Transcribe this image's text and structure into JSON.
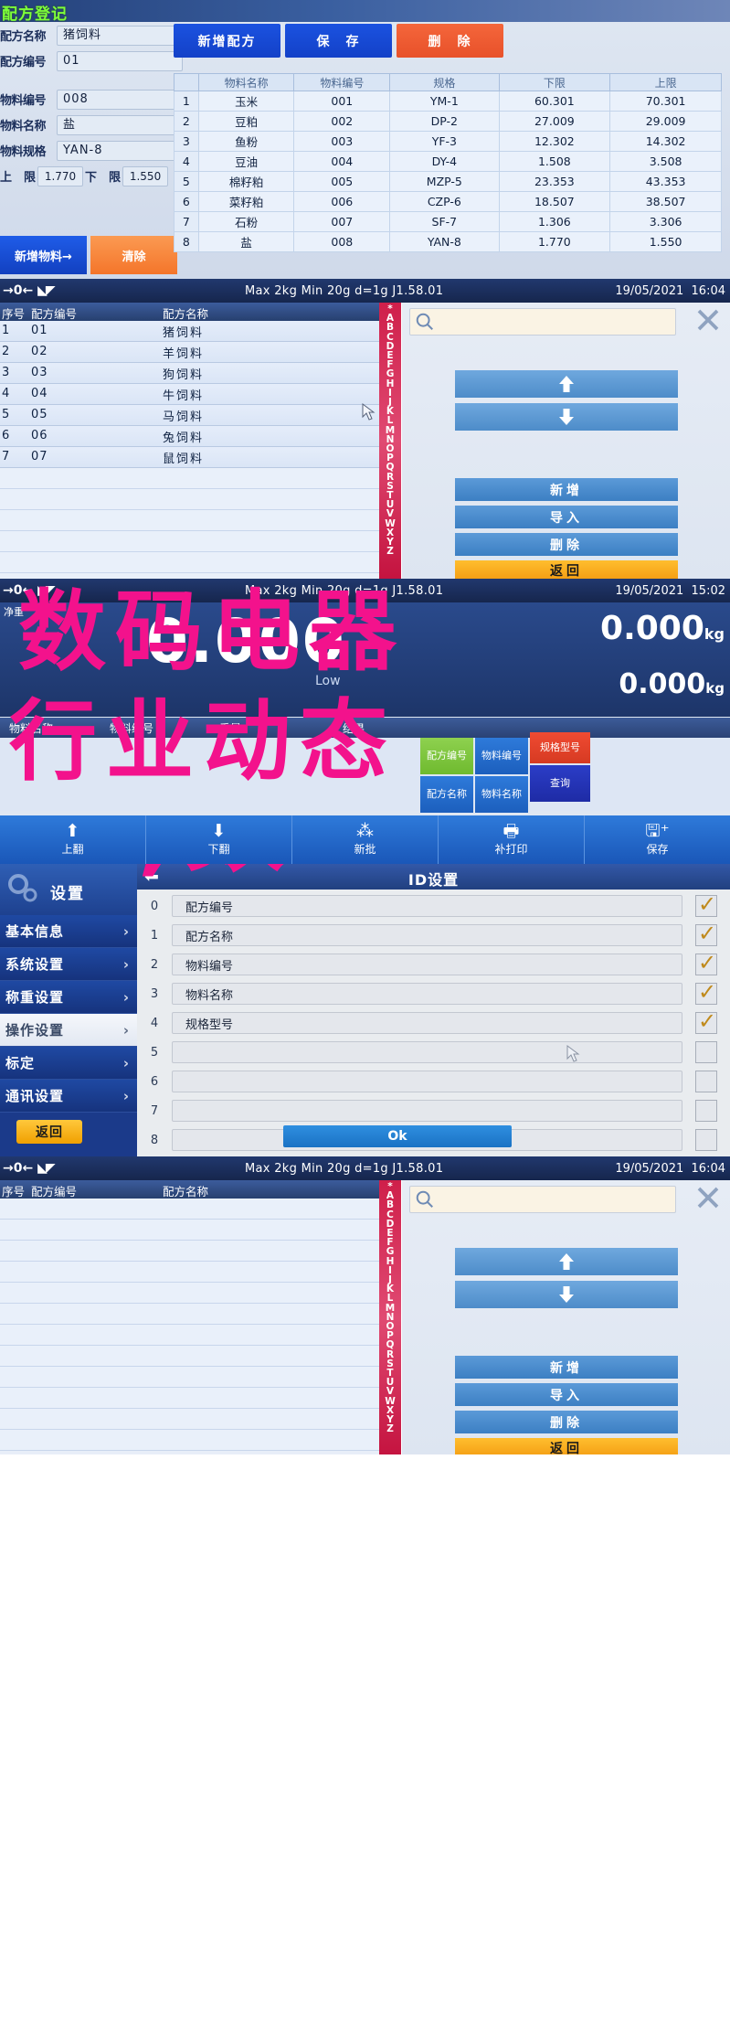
{
  "panel1": {
    "title": "配方登记",
    "fields": [
      {
        "label": "配方名称",
        "value": "猪饲料"
      },
      {
        "label": "配方编号",
        "value": "01"
      },
      {
        "label": "物料编号",
        "value": "008"
      },
      {
        "label": "物料名称",
        "value": "盐"
      },
      {
        "label": "物料规格",
        "value": "YAN-8"
      }
    ],
    "limits": {
      "lower_label": "上　限",
      "lower_value": "1.770",
      "upper_label": "下　限",
      "upper_value": "1.550"
    },
    "buttons": {
      "add_recipe": "新增配方",
      "save": "保　存",
      "delete": "删　除",
      "add_material": "新增物料→",
      "clear": "清除"
    },
    "table": {
      "headers": [
        "",
        "物料名称",
        "物料编号",
        "规格",
        "下限",
        "上限"
      ],
      "rows": [
        [
          "1",
          "玉米",
          "001",
          "YM-1",
          "60.301",
          "70.301"
        ],
        [
          "2",
          "豆粕",
          "002",
          "DP-2",
          "27.009",
          "29.009"
        ],
        [
          "3",
          "鱼粉",
          "003",
          "YF-3",
          "12.302",
          "14.302"
        ],
        [
          "4",
          "豆油",
          "004",
          "DY-4",
          "1.508",
          "3.508"
        ],
        [
          "5",
          "棉籽粕",
          "005",
          "MZP-5",
          "23.353",
          "43.353"
        ],
        [
          "6",
          "菜籽粕",
          "006",
          "CZP-6",
          "18.507",
          "38.507"
        ],
        [
          "7",
          "石粉",
          "007",
          "SF-7",
          "1.306",
          "3.306"
        ],
        [
          "8",
          "盐",
          "008",
          "YAN-8",
          "1.770",
          "1.550"
        ]
      ]
    }
  },
  "statusbar": {
    "left": "→0←",
    "spec": "Max 2kg  Min 20g  d=1g    J1.58.01",
    "date": "19/05/2021",
    "time": "16:04"
  },
  "statusbar3": {
    "left": "→0←",
    "spec": "Max 2kg  Min 20g  d=1g    J1.58.01",
    "date": "19/05/2021",
    "time": "15:02"
  },
  "panel2": {
    "headers": {
      "index": "序号",
      "code": "配方编号",
      "name": "配方名称"
    },
    "rows": [
      {
        "index": "1",
        "code": "01",
        "name": "猪饲料"
      },
      {
        "index": "2",
        "code": "02",
        "name": "羊饲料"
      },
      {
        "index": "3",
        "code": "03",
        "name": "狗饲料"
      },
      {
        "index": "4",
        "code": "04",
        "name": "牛饲料"
      },
      {
        "index": "5",
        "code": "05",
        "name": "马饲料"
      },
      {
        "index": "6",
        "code": "06",
        "name": "兔饲料"
      },
      {
        "index": "7",
        "code": "07",
        "name": "鼠饲料"
      }
    ],
    "alphabet": "*ABCDEFGHIJKLMNOPQRSTUVWXYZ",
    "search_value": "",
    "buttons": {
      "add": "新增",
      "import": "导入",
      "delete": "删除",
      "back": "返回"
    }
  },
  "panel3": {
    "net_label": "净重",
    "weight_big": "0.000",
    "unit1": "0.000",
    "unit1_suffix": "kg",
    "low_label": "Low",
    "unit2": "0.000",
    "unit2_suffix": "kg",
    "table_headers": [
      "物料名称",
      "物料编号",
      "重量",
      "结果"
    ],
    "tiles": [
      {
        "label": "配方编号",
        "color": "green"
      },
      {
        "label": "配方名称",
        "color": "blue"
      },
      {
        "label": "物料编号",
        "color": "blue"
      },
      {
        "label": "物料名称",
        "color": "blue"
      },
      {
        "label": "规格型号",
        "color": "red"
      },
      {
        "label": "查询",
        "color": "navy"
      }
    ],
    "toolbar": [
      {
        "label": "上翻",
        "icon": "arrow-up-icon"
      },
      {
        "label": "下翻",
        "icon": "arrow-down-icon"
      },
      {
        "label": "新批",
        "icon": "batch-icon"
      },
      {
        "label": "补打印",
        "icon": "printer-icon"
      },
      {
        "label": "保存",
        "icon": "save-icon"
      }
    ]
  },
  "panel4": {
    "sidebar_title": "设置",
    "sidebar_items": [
      {
        "label": "基本信息",
        "active": false
      },
      {
        "label": "系统设置",
        "active": false
      },
      {
        "label": "称重设置",
        "active": false
      },
      {
        "label": "操作设置",
        "active": true
      },
      {
        "label": "标定",
        "active": false
      },
      {
        "label": "通讯设置",
        "active": false
      }
    ],
    "back_button": "返回",
    "dialog_title": "ID设置",
    "rows": [
      {
        "num": "0",
        "value": "配方编号",
        "checked": true
      },
      {
        "num": "1",
        "value": "配方名称",
        "checked": true
      },
      {
        "num": "2",
        "value": "物料编号",
        "checked": true
      },
      {
        "num": "3",
        "value": "物料名称",
        "checked": true
      },
      {
        "num": "4",
        "value": "规格型号",
        "checked": true
      },
      {
        "num": "5",
        "value": "",
        "checked": false
      },
      {
        "num": "6",
        "value": "",
        "checked": false
      },
      {
        "num": "7",
        "value": "",
        "checked": false
      },
      {
        "num": "8",
        "value": "",
        "checked": false
      }
    ],
    "ok_button": "Ok"
  },
  "panel5": {
    "headers": {
      "index": "序号",
      "code": "配方编号",
      "name": "配方名称"
    },
    "alphabet": "*ABCDEFGHIJKLMNOPQRSTUVWXYZ",
    "buttons": {
      "add": "新增",
      "import": "导入",
      "delete": "删除",
      "back": "返回"
    }
  },
  "overlay": {
    "line1": "数码电器",
    "line2": "行业动态",
    "line3": ",数",
    "color": "#f3128c"
  }
}
